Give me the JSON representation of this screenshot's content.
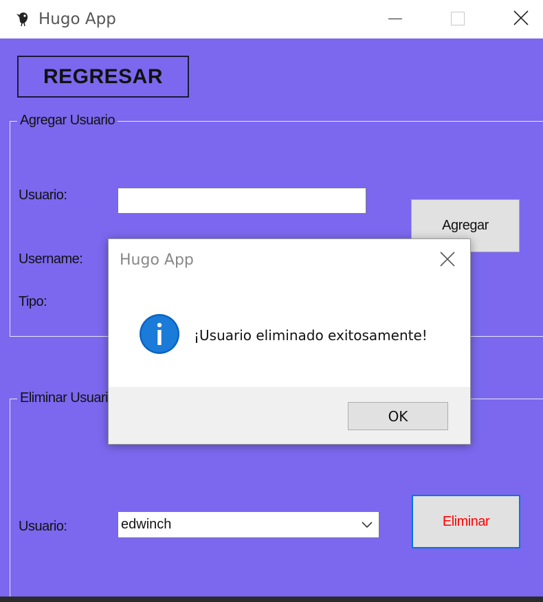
{
  "window": {
    "title": "Hugo App",
    "background_color": "#7b68ee"
  },
  "toolbar": {
    "back_label": "REGRESAR"
  },
  "add_user": {
    "legend": "Agregar Usuario",
    "usuario_label": "Usuario:",
    "usuario_value": "",
    "username_label": "Username:",
    "tipo_label": "Tipo:",
    "add_button": "Agregar"
  },
  "delete_user": {
    "legend": "Eliminar Usuario",
    "usuario_label": "Usuario:",
    "selected_user": "edwinch",
    "delete_button": "Eliminar",
    "delete_color": "#ff0000"
  },
  "dialog": {
    "title": "Hugo App",
    "message": "¡Usuario eliminado exitosamente!",
    "icon": "info-icon",
    "ok_label": "OK"
  }
}
